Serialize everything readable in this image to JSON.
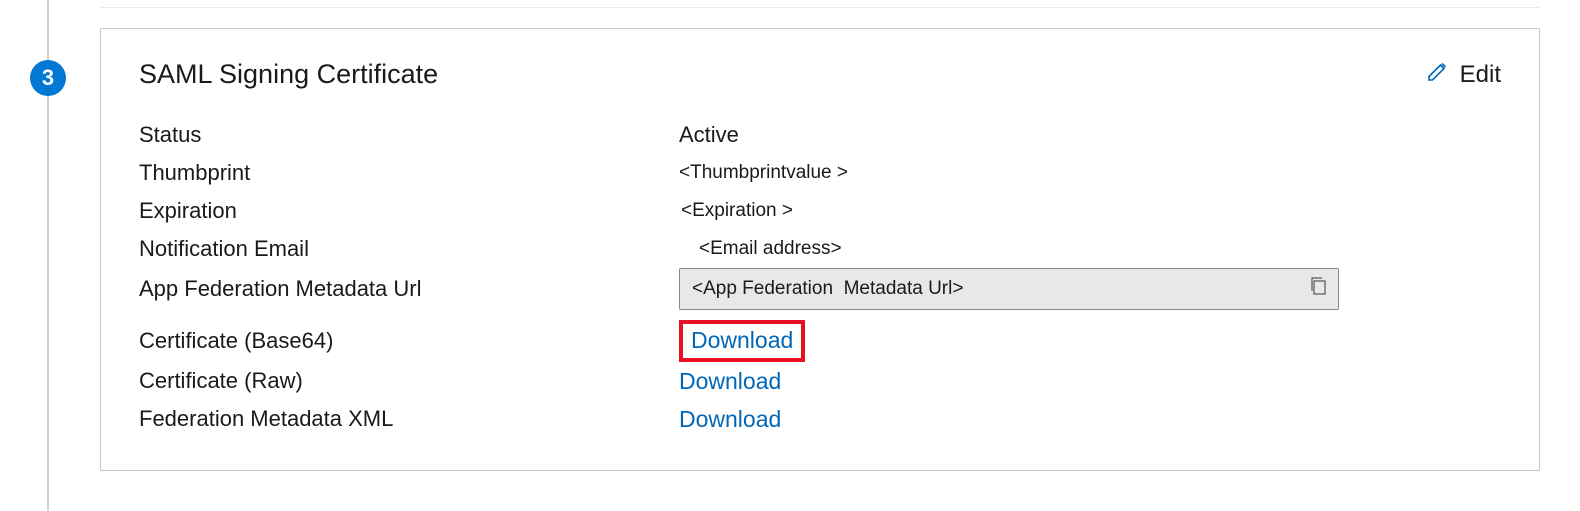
{
  "stepNumber": "3",
  "card": {
    "title": "SAML Signing Certificate",
    "editLabel": "Edit"
  },
  "fields": {
    "status": {
      "label": "Status",
      "value": "Active"
    },
    "thumbprint": {
      "label": "Thumbprint",
      "value": "<Thumbprintvalue >"
    },
    "expiration": {
      "label": "Expiration",
      "value": "<Expiration >"
    },
    "notificationEmail": {
      "label": "Notification Email",
      "value": "<Email address>"
    },
    "metadataUrl": {
      "label": "App Federation Metadata Url",
      "value": "<App Federation  Metadata Url>"
    },
    "certBase64": {
      "label": "Certificate (Base64)",
      "link": "Download"
    },
    "certRaw": {
      "label": "Certificate (Raw)",
      "link": "Download"
    },
    "fedXml": {
      "label": "Federation Metadata XML",
      "link": "Download"
    }
  }
}
